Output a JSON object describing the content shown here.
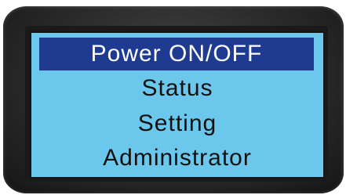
{
  "menu": {
    "items": [
      {
        "label": "Power ON/OFF",
        "selected": true
      },
      {
        "label": "Status",
        "selected": false
      },
      {
        "label": "Setting",
        "selected": false
      },
      {
        "label": "Administrator",
        "selected": false
      }
    ]
  },
  "colors": {
    "screen_background": "#6cc7ec",
    "selection_highlight": "#1f3b91",
    "selected_text": "#ffffff",
    "text": "#111111",
    "device_body": "#2b2b2b"
  }
}
